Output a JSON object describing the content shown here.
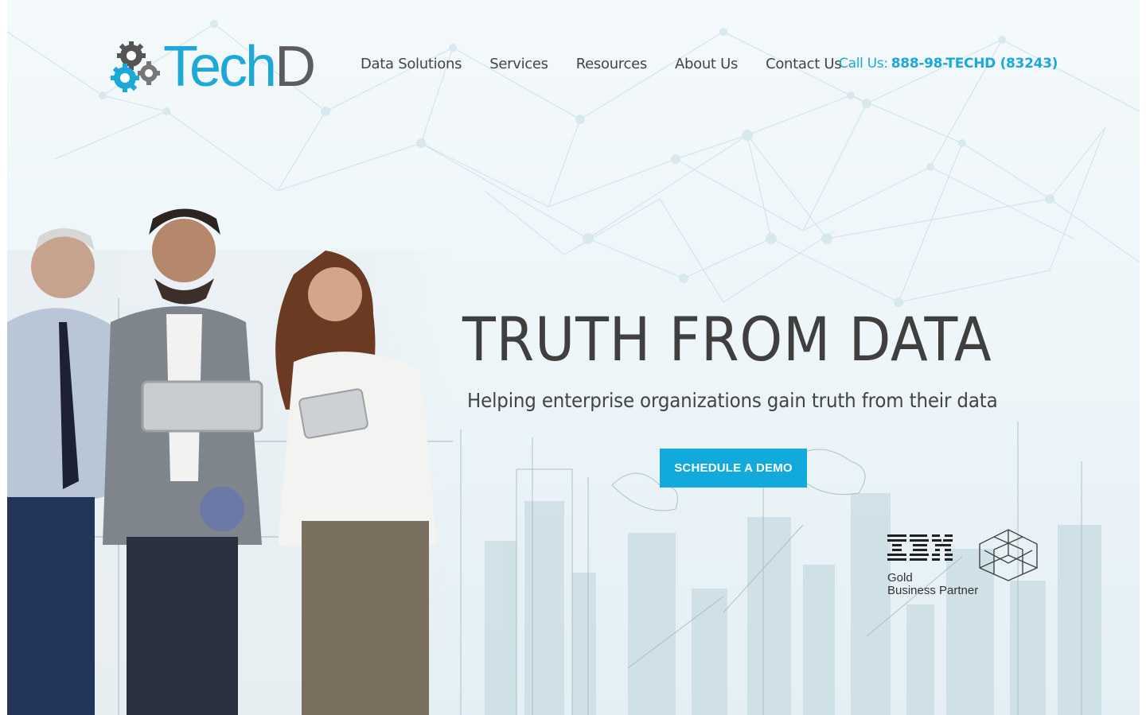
{
  "brand": {
    "name_primary": "Tech",
    "name_secondary": "D",
    "color_primary": "#1ea8d8",
    "color_secondary": "#5c5c5c"
  },
  "nav": {
    "items": [
      {
        "label": "Data Solutions"
      },
      {
        "label": "Services"
      },
      {
        "label": "Resources"
      },
      {
        "label": "About Us"
      },
      {
        "label": "Contact Us"
      }
    ]
  },
  "contact": {
    "call_label": "Call Us:",
    "phone": "888-98-TECHD (83243)"
  },
  "hero": {
    "title": "TRUTH FROM DATA",
    "subtitle": "Helping enterprise organizations gain truth from their data",
    "cta_label": "SCHEDULE A DEMO",
    "cta_color": "#12a9dd"
  },
  "partner": {
    "company": "IBM",
    "tier": "Gold",
    "type": "Business Partner"
  },
  "icons": {
    "logo": "gears-icon",
    "badge": "cube-icon"
  }
}
